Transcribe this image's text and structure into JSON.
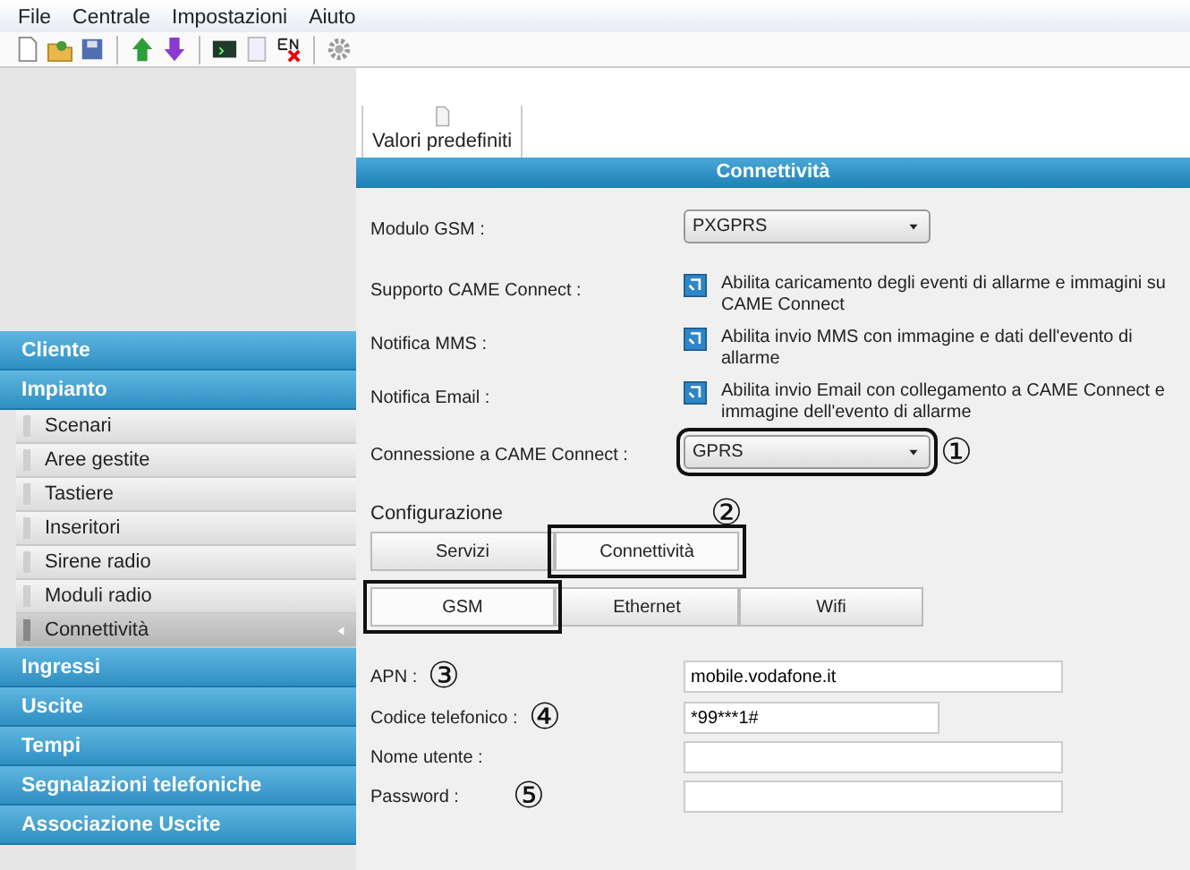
{
  "menu": [
    "File",
    "Centrale",
    "Impostazioni",
    "Aiuto"
  ],
  "doc_tab": {
    "label": "Valori predefiniti"
  },
  "sidebar": [
    {
      "label": "Cliente",
      "kind": "header"
    },
    {
      "label": "Impianto",
      "kind": "header"
    },
    {
      "label": "Scenari",
      "kind": "sub",
      "selected": false
    },
    {
      "label": "Aree gestite",
      "kind": "sub",
      "selected": false
    },
    {
      "label": "Tastiere",
      "kind": "sub",
      "selected": false
    },
    {
      "label": "Inseritori",
      "kind": "sub",
      "selected": false
    },
    {
      "label": "Sirene radio",
      "kind": "sub",
      "selected": false
    },
    {
      "label": "Moduli radio",
      "kind": "sub",
      "selected": false
    },
    {
      "label": "Connettività",
      "kind": "sub",
      "selected": true
    },
    {
      "label": "Ingressi",
      "kind": "header"
    },
    {
      "label": "Uscite",
      "kind": "header"
    },
    {
      "label": "Tempi",
      "kind": "header"
    },
    {
      "label": "Segnalazioni telefoniche",
      "kind": "header"
    },
    {
      "label": "Associazione Uscite",
      "kind": "header"
    }
  ],
  "panel_title": "Connettività",
  "settings": [
    {
      "kind": "select",
      "label": "Modulo GSM :",
      "value": "PXGPRS"
    },
    {
      "kind": "check",
      "label": "Supporto CAME Connect :",
      "text": "Abilita caricamento degli eventi di allarme e immagini su CAME Connect",
      "checked": true
    },
    {
      "kind": "check",
      "label": "Notifica MMS :",
      "text": "Abilita invio MMS con immagine e dati dell'evento di allarme",
      "checked": true
    },
    {
      "kind": "check",
      "label": "Notifica Email :",
      "text": "Abilita invio Email con collegamento a CAME Connect  e immagine dell'evento di allarme",
      "checked": true
    },
    {
      "kind": "select",
      "label": "Connessione a CAME Connect :",
      "value": "GPRS",
      "highlighted": true,
      "callout": "①"
    }
  ],
  "configuration": {
    "label": "Configurazione",
    "callout": "②",
    "tabs": [
      {
        "label": "Servizi",
        "selected": false,
        "highlighted": false
      },
      {
        "label": "Connettività",
        "selected": true,
        "highlighted": true
      }
    ],
    "subtabs": [
      {
        "label": "GSM",
        "selected": true,
        "highlighted": true
      },
      {
        "label": "Ethernet",
        "selected": false,
        "highlighted": false
      },
      {
        "label": "Wifi",
        "selected": false,
        "highlighted": false
      }
    ]
  },
  "fields": [
    {
      "label": "APN :",
      "value": "mobile.vodafone.it",
      "callout": "③"
    },
    {
      "label": "Codice telefonico :",
      "value": "*99***1#",
      "callout": "④"
    },
    {
      "label": "Nome utente :"
    },
    {
      "label": "Password :",
      "callout": "⑤"
    }
  ]
}
